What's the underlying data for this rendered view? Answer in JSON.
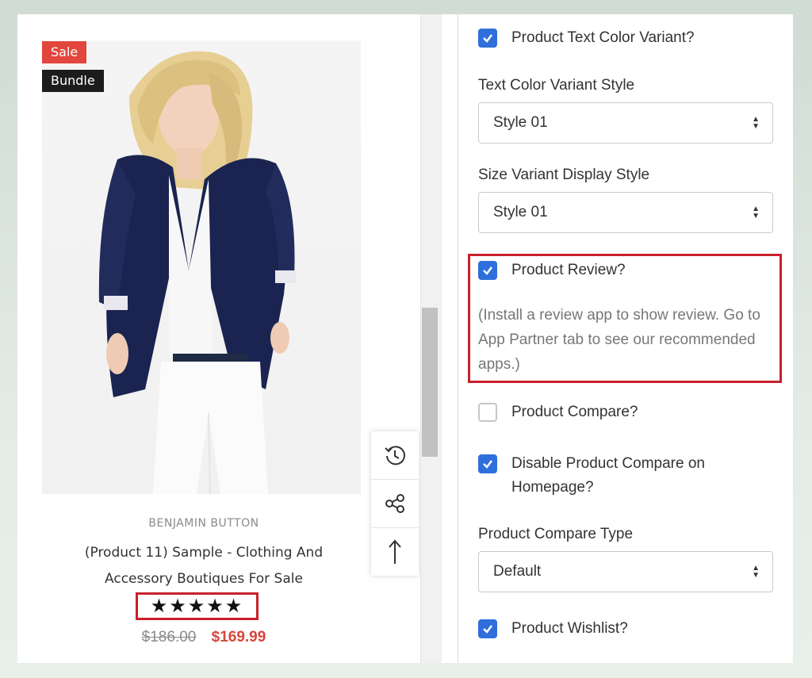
{
  "product": {
    "badges": {
      "sale": "Sale",
      "bundle": "Bundle"
    },
    "vendor": "BENJAMIN BUTTON",
    "title": "(Product 11) Sample - Clothing And Accessory Boutiques For Sale",
    "rating": "★★★★★",
    "rating_value": 5,
    "price_old": "$186.00",
    "price_new": "$169.99"
  },
  "tools": {
    "icons": [
      "history-icon",
      "share-icon",
      "arrow-up-icon"
    ]
  },
  "settings": {
    "text_color_variant": {
      "label": "Product Text Color Variant?",
      "checked": true
    },
    "text_color_variant_style": {
      "label": "Text Color Variant Style",
      "value": "Style 01"
    },
    "size_variant_style": {
      "label": "Size Variant Display Style",
      "value": "Style 01"
    },
    "product_review": {
      "label": "Product Review?",
      "checked": true,
      "note": "(Install a review app to show review. Go to App Partner tab to see our recommended apps.)"
    },
    "product_compare": {
      "label": "Product Compare?",
      "checked": false
    },
    "disable_compare_homepage": {
      "label": "Disable Product Compare on Homepage?",
      "checked": true
    },
    "product_compare_type": {
      "label": "Product Compare Type",
      "value": "Default"
    },
    "product_wishlist": {
      "label": "Product Wishlist?",
      "checked": true
    }
  },
  "colors": {
    "accent": "#2f6fdb",
    "sale": "#e2463c",
    "highlight": "#c9202c",
    "price": "#d9453c"
  }
}
